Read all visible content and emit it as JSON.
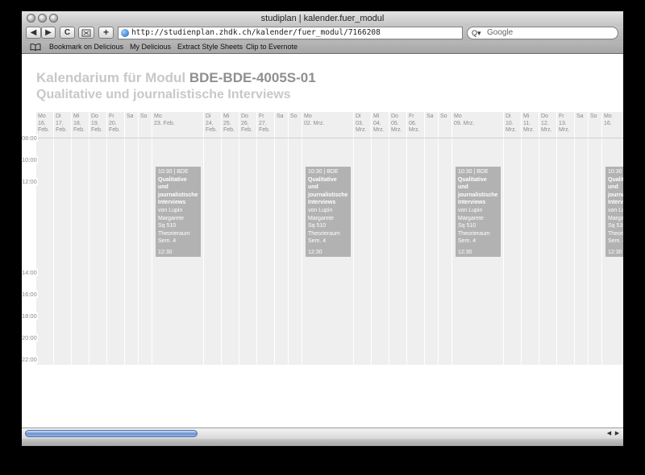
{
  "window": {
    "title": "studiplan | kalender.fuer_modul"
  },
  "toolbar": {
    "back": "◀",
    "forward": "▶",
    "reload": "C",
    "add": "+",
    "url": "http://studienplan.zhdk.ch/kalender/fuer_modul/7166208",
    "search_placeholder": "Google",
    "search_glyph": "Q▾"
  },
  "bookmarks": {
    "book_icon": "open-book-icon",
    "items": [
      "Bookmark on Delicious",
      "My Delicious",
      "Extract Style Sheets",
      "Clip to Evernote"
    ]
  },
  "page": {
    "title_prefix": "Kalendarium für Modul",
    "module_code": "BDE-BDE-4005S-01",
    "subtitle": "Qualitative und journalistische Interviews"
  },
  "calendar": {
    "times": [
      "08:00",
      "10:00",
      "12:00",
      "14:00",
      "16:00",
      "18:00",
      "20:00",
      "22:00"
    ],
    "days": [
      {
        "day": "Mo",
        "date": "16.",
        "month": "Feb."
      },
      {
        "day": "Di",
        "date": "17.",
        "month": "Feb."
      },
      {
        "day": "Mi",
        "date": "18.",
        "month": "Feb."
      },
      {
        "day": "Do",
        "date": "19.",
        "month": "Feb."
      },
      {
        "day": "Fr",
        "date": "20.",
        "month": "Feb."
      },
      {
        "day": "Sa",
        "date": "",
        "month": ""
      },
      {
        "day": "So",
        "date": "",
        "month": ""
      },
      {
        "day": "Mo",
        "date": "23. Feb.",
        "month": ""
      },
      {
        "day": "Di",
        "date": "24.",
        "month": "Feb."
      },
      {
        "day": "Mi",
        "date": "25.",
        "month": "Feb."
      },
      {
        "day": "Do",
        "date": "26.",
        "month": "Feb."
      },
      {
        "day": "Fr",
        "date": "27.",
        "month": "Feb."
      },
      {
        "day": "Sa",
        "date": "",
        "month": ""
      },
      {
        "day": "So",
        "date": "",
        "month": ""
      },
      {
        "day": "Mo",
        "date": "02. Mrz.",
        "month": ""
      },
      {
        "day": "Di",
        "date": "03.",
        "month": "Mrz."
      },
      {
        "day": "Mi",
        "date": "04.",
        "month": "Mrz."
      },
      {
        "day": "Do",
        "date": "05.",
        "month": "Mrz."
      },
      {
        "day": "Fr",
        "date": "06.",
        "month": "Mrz."
      },
      {
        "day": "Sa",
        "date": "",
        "month": ""
      },
      {
        "day": "So",
        "date": "",
        "month": ""
      },
      {
        "day": "Mo",
        "date": "09. Mrz.",
        "month": ""
      },
      {
        "day": "Di",
        "date": "10.",
        "month": "Mrz."
      },
      {
        "day": "Mi",
        "date": "11.",
        "month": "Mrz."
      },
      {
        "day": "Do",
        "date": "12.",
        "month": "Mrz."
      },
      {
        "day": "Fr",
        "date": "13.",
        "month": "Mrz."
      },
      {
        "day": "Sa",
        "date": "",
        "month": ""
      },
      {
        "day": "So",
        "date": "",
        "month": ""
      },
      {
        "day": "Mo",
        "date": "16.",
        "month": ""
      }
    ],
    "event": {
      "start": "10:30 | BDE",
      "title": "Qualitative und journalistische Interviews",
      "lecturer": "von Lupin Margarete",
      "room": "Sq 510 Theorieraum",
      "semester": "Sem. 4",
      "end": "12:30"
    }
  }
}
